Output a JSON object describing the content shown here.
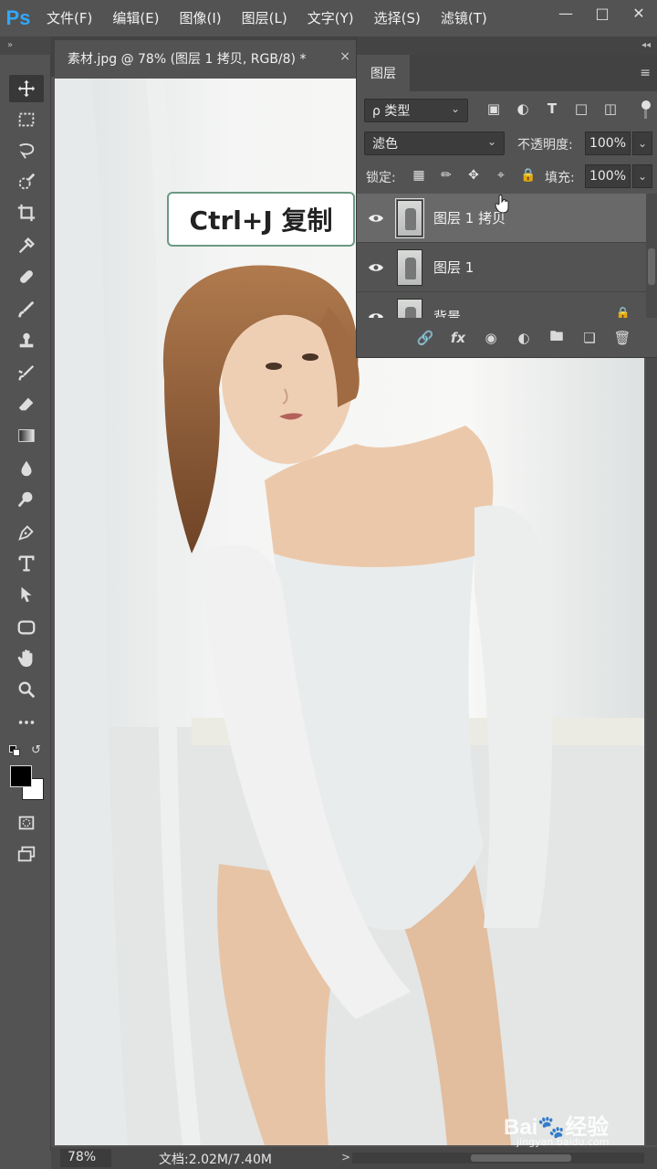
{
  "app": {
    "logo": "Ps"
  },
  "menu": [
    "文件(F)",
    "编辑(E)",
    "图像(I)",
    "图层(L)",
    "文字(Y)",
    "选择(S)",
    "滤镜(T)"
  ],
  "window_controls": [
    "minimize-icon",
    "restore-icon",
    "close-icon"
  ],
  "document": {
    "tab_title": "素材.jpg @ 78% (图层 1 拷贝, RGB/8) *",
    "close_glyph": "×"
  },
  "callout": {
    "text": "Ctrl+J  复制"
  },
  "layers_panel": {
    "tab_label": "图层",
    "filter": {
      "label": "ρ 类型"
    },
    "blend_mode": "滤色",
    "opacity_label": "不透明度:",
    "opacity_value": "100%",
    "lock_label": "锁定:",
    "fill_label": "填充:",
    "fill_value": "100%",
    "layers": [
      {
        "name": "图层 1 拷贝",
        "selected": true,
        "visible": true,
        "locked": false
      },
      {
        "name": "图层 1",
        "selected": false,
        "visible": true,
        "locked": false
      },
      {
        "name": "背景",
        "selected": false,
        "visible": true,
        "locked": true
      }
    ],
    "footer_icons": [
      "link-layers-icon",
      "fx-icon",
      "layer-mask-icon",
      "adjustment-layer-icon",
      "group-folder-icon",
      "new-layer-icon",
      "delete-layer-icon"
    ]
  },
  "status": {
    "zoom": "78%",
    "doc_info": "文档:2.02M/7.40M",
    "arrow": ">"
  },
  "watermark": {
    "brand": "Bai🐾经验",
    "url": "jingyan.baidu.com"
  },
  "tools": [
    "move",
    "marquee",
    "lasso",
    "quick-select",
    "crop",
    "eyedropper",
    "healing",
    "brush",
    "stamp",
    "history-brush",
    "eraser",
    "gradient",
    "blur",
    "dodge",
    "pen",
    "type",
    "path-select",
    "shape",
    "hand",
    "zoom",
    "more"
  ]
}
